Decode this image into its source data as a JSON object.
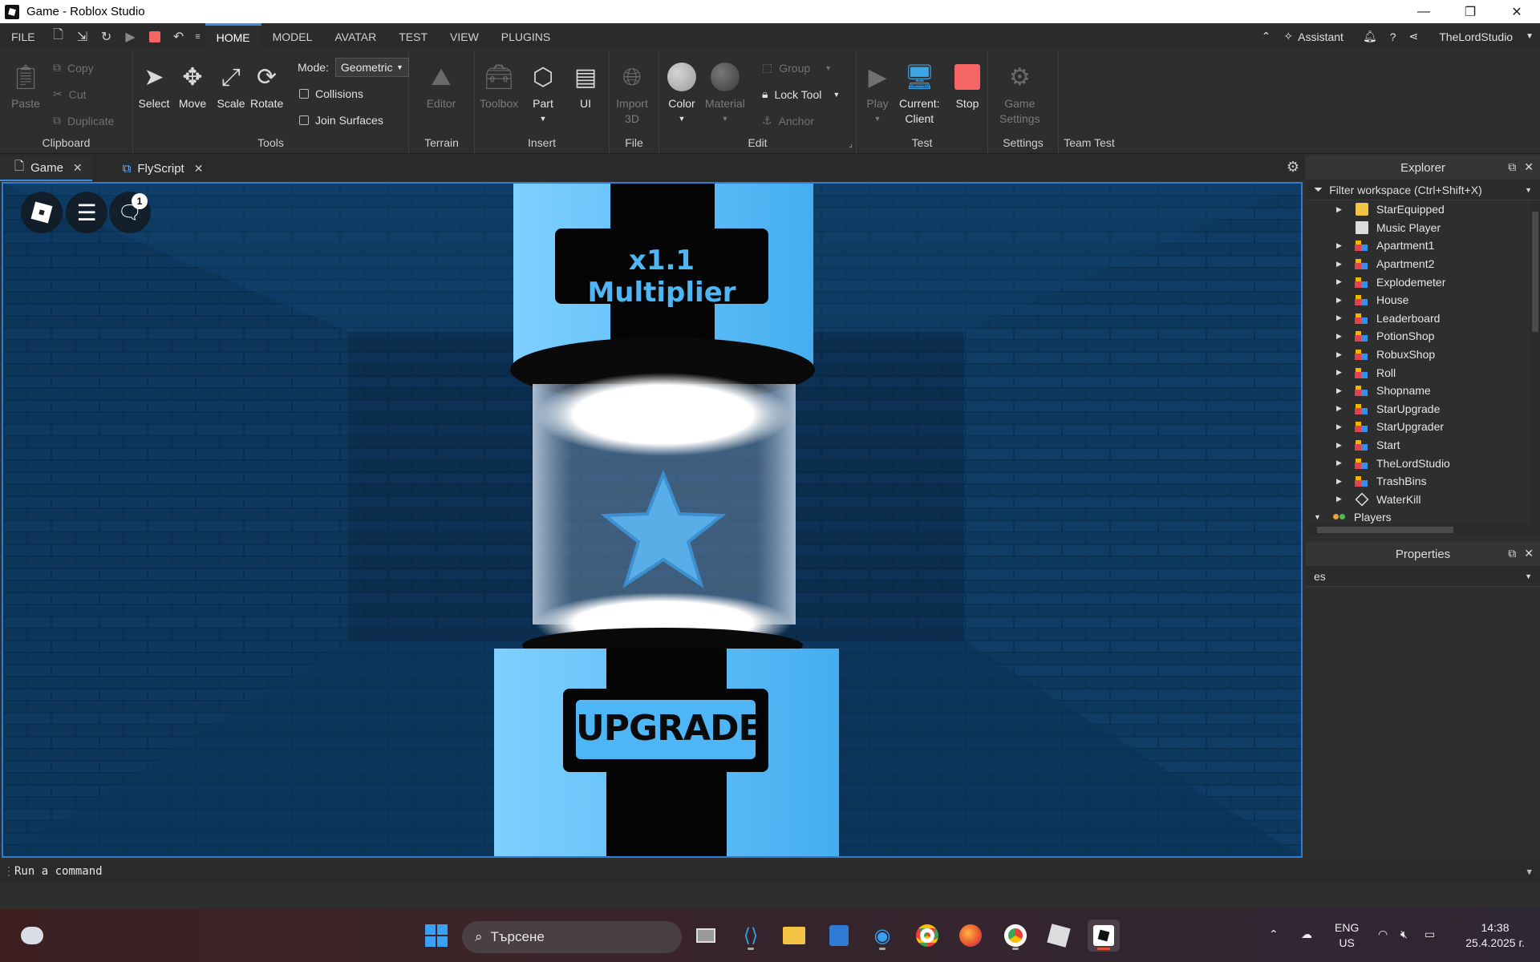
{
  "window": {
    "title": "Game - Roblox Studio",
    "min": "—",
    "restore": "❐",
    "close": "✕"
  },
  "menu": {
    "file": "FILE",
    "tabs": [
      "HOME",
      "MODEL",
      "AVATAR",
      "TEST",
      "VIEW",
      "PLUGINS"
    ],
    "assistant": "Assistant",
    "user": "TheLordStudio"
  },
  "ribbon": {
    "clipboard": {
      "label": "Clipboard",
      "paste": "Paste",
      "copy": "Copy",
      "cut": "Cut",
      "duplicate": "Duplicate"
    },
    "tools": {
      "label": "Tools",
      "select": "Select",
      "move": "Move",
      "scale": "Scale",
      "rotate": "Rotate",
      "mode_label": "Mode:",
      "mode_value": "Geometric",
      "collisions": "Collisions",
      "join_surfaces": "Join Surfaces"
    },
    "terrain": {
      "label": "Terrain",
      "editor": "Editor"
    },
    "insert": {
      "label": "Insert",
      "toolbox": "Toolbox",
      "part": "Part",
      "ui": "UI"
    },
    "file": {
      "label": "File",
      "import3d_line1": "Import",
      "import3d_line2": "3D"
    },
    "edit": {
      "label": "Edit",
      "color": "Color",
      "material": "Material",
      "group": "Group",
      "lock_tool": "Lock Tool",
      "anchor": "Anchor"
    },
    "test": {
      "label": "Test",
      "play": "Play",
      "current_line1": "Current:",
      "current_line2": "Client",
      "stop": "Stop"
    },
    "settings": {
      "label": "Settings",
      "game_line1": "Game",
      "game_line2": "Settings"
    },
    "team_test": {
      "label": "Team Test"
    }
  },
  "doc_tabs": [
    {
      "label": "Game",
      "active": true
    },
    {
      "label": "FlyScript",
      "active": false
    }
  ],
  "viewport": {
    "chat_badge": "1",
    "sign_top": "x1.1 Multiplier",
    "sign_bottom": "UPGRADE"
  },
  "explorer": {
    "title": "Explorer",
    "filter_placeholder": "Filter workspace (Ctrl+Shift+X)",
    "items": [
      {
        "label": "StarEquipped",
        "icon": "folder",
        "expandable": true
      },
      {
        "label": "Music Player",
        "icon": "script",
        "expandable": false
      },
      {
        "label": "Apartment1",
        "icon": "model",
        "expandable": true
      },
      {
        "label": "Apartment2",
        "icon": "model",
        "expandable": true
      },
      {
        "label": "Explodemeter",
        "icon": "model",
        "expandable": true
      },
      {
        "label": "House",
        "icon": "model",
        "expandable": true
      },
      {
        "label": "Leaderboard",
        "icon": "model",
        "expandable": true
      },
      {
        "label": "PotionShop",
        "icon": "model",
        "expandable": true
      },
      {
        "label": "RobuxShop",
        "icon": "model",
        "expandable": true
      },
      {
        "label": "Roll",
        "icon": "model",
        "expandable": true
      },
      {
        "label": "Shopname",
        "icon": "model",
        "expandable": true
      },
      {
        "label": "StarUpgrade",
        "icon": "model",
        "expandable": true
      },
      {
        "label": "StarUpgrader",
        "icon": "model",
        "expandable": true
      },
      {
        "label": "Start",
        "icon": "model",
        "expandable": true
      },
      {
        "label": "TheLordStudio",
        "icon": "model",
        "expandable": true
      },
      {
        "label": "TrashBins",
        "icon": "model",
        "expandable": true
      },
      {
        "label": "WaterKill",
        "icon": "part",
        "expandable": true
      },
      {
        "label": "Players",
        "icon": "players",
        "expandable": true,
        "expanded": true
      }
    ]
  },
  "properties": {
    "title": "Properties",
    "filter_value": "es"
  },
  "command_bar": {
    "placeholder": "Run a command"
  },
  "taskbar": {
    "search": "Търсене",
    "lang_line1": "ENG",
    "lang_line2": "US",
    "time": "14:38",
    "date": "25.4.2025 г."
  },
  "colors": {
    "accent": "#3a8ee6",
    "stop_red": "#f56565",
    "pillar_blue": "#4fb6f5",
    "wall_blue": "#0e3a63"
  }
}
